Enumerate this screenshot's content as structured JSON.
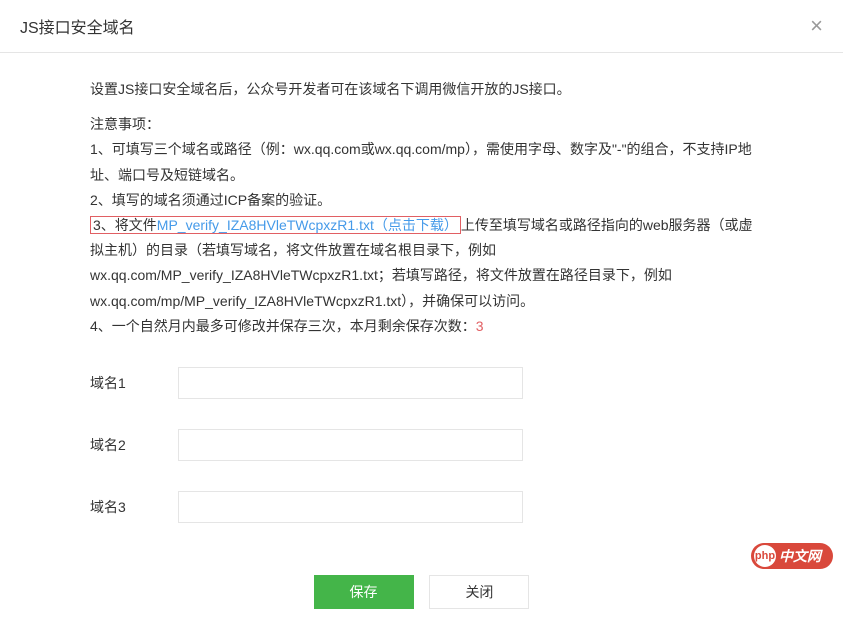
{
  "header": {
    "title": "JS接口安全域名"
  },
  "intro": "设置JS接口安全域名后，公众号开发者可在该域名下调用微信开放的JS接口。",
  "notice_title": "注意事项：",
  "notice_items": {
    "item1": "1、可填写三个域名或路径（例：wx.qq.com或wx.qq.com/mp），需使用字母、数字及\"-\"的组合，不支持IP地址、端口号及短链域名。",
    "item2": "2、填写的域名须通过ICP备案的验证。",
    "item3_prefix": "3、将文件",
    "item3_link": "MP_verify_IZA8HVleTWcpxzR1.txt（点击下载）",
    "item3_suffix": "上传至填写域名或路径指向的web服务器（或虚拟主机）的目录（若填写域名，将文件放置在域名根目录下，例如wx.qq.com/MP_verify_IZA8HVleTWcpxzR1.txt；若填写路径，将文件放置在路径目录下，例如wx.qq.com/mp/MP_verify_IZA8HVleTWcpxzR1.txt），并确保可以访问。",
    "item4_text": "4、一个自然月内最多可修改并保存三次，本月剩余保存次数：",
    "item4_count": "3"
  },
  "form": {
    "fields": [
      {
        "label": "域名1",
        "value": ""
      },
      {
        "label": "域名2",
        "value": ""
      },
      {
        "label": "域名3",
        "value": ""
      }
    ]
  },
  "footer": {
    "save_label": "保存",
    "close_label": "关闭"
  },
  "watermark": {
    "icon": "php",
    "text": "中文网"
  }
}
